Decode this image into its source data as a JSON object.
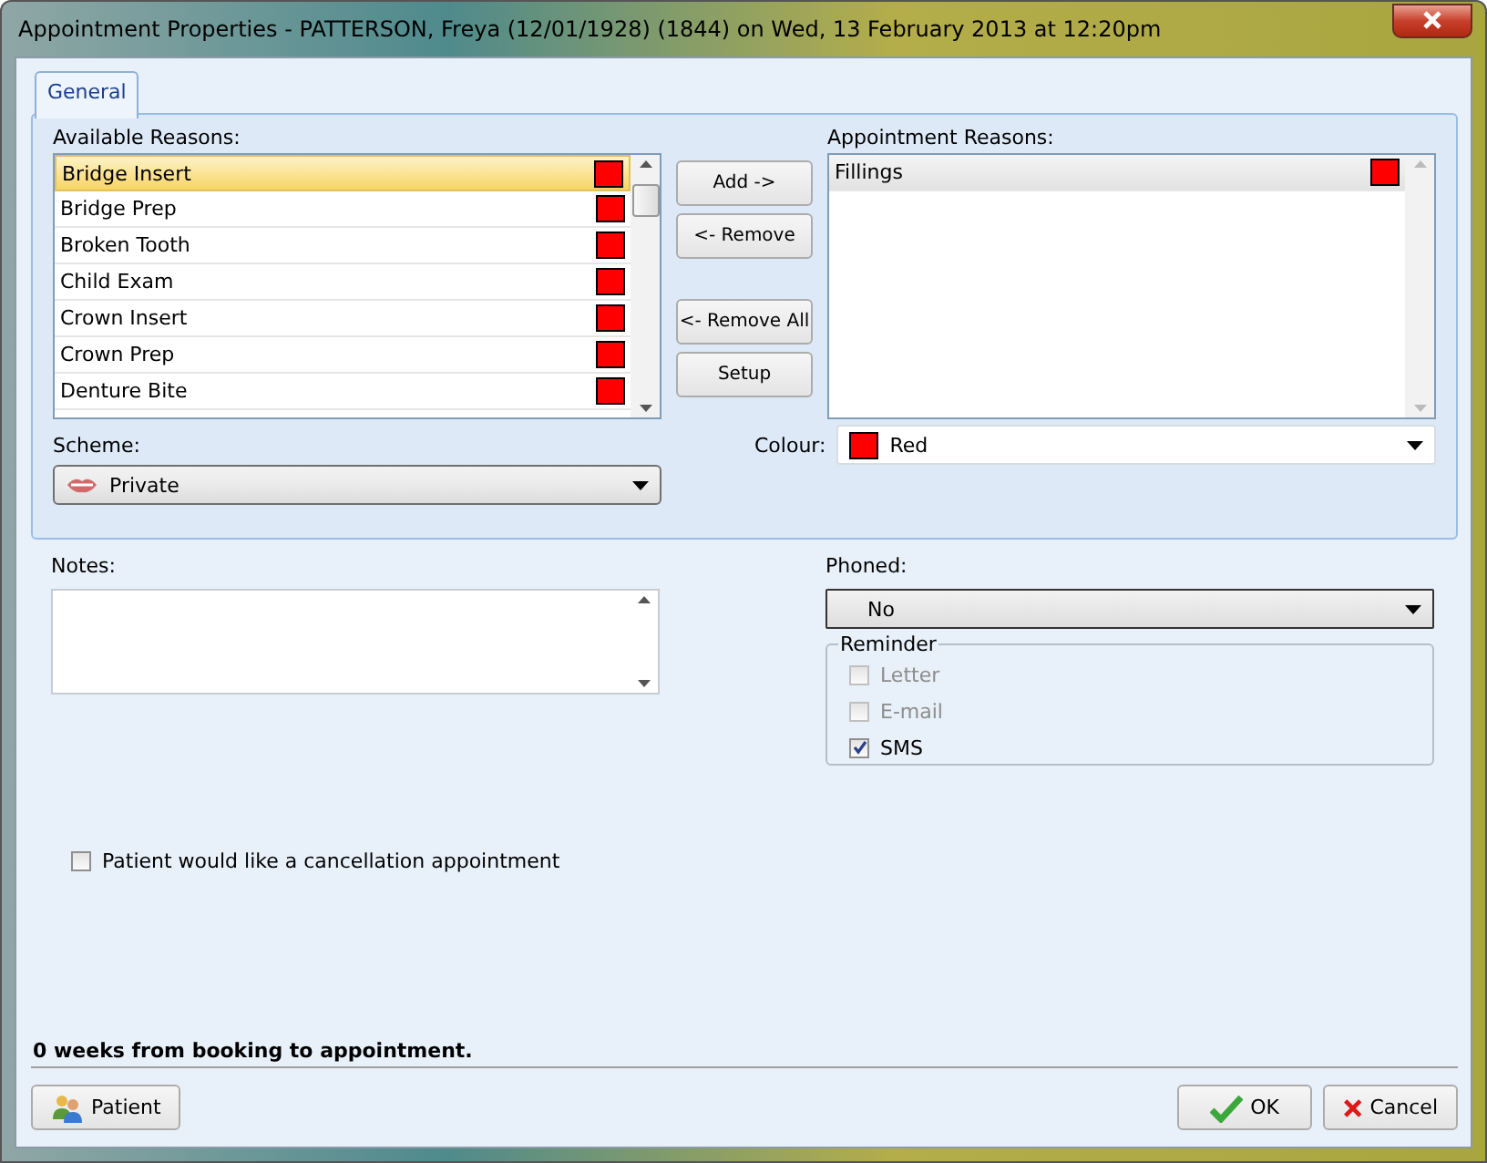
{
  "window": {
    "title": "Appointment Properties - PATTERSON, Freya (12/01/1928) (1844) on Wed, 13 February 2013 at 12:20pm"
  },
  "tabs": [
    {
      "label": "General",
      "selected": true
    }
  ],
  "available_reasons": {
    "label": "Available Reasons:",
    "items": [
      {
        "name": "Bridge Insert",
        "color": "#ff0000",
        "selected": true
      },
      {
        "name": "Bridge Prep",
        "color": "#ff0000",
        "selected": false
      },
      {
        "name": "Broken Tooth",
        "color": "#ff0000",
        "selected": false
      },
      {
        "name": "Child Exam",
        "color": "#ff0000",
        "selected": false
      },
      {
        "name": "Crown Insert",
        "color": "#ff0000",
        "selected": false
      },
      {
        "name": "Crown Prep",
        "color": "#ff0000",
        "selected": false
      },
      {
        "name": "Denture Bite",
        "color": "#ff0000",
        "selected": false
      }
    ]
  },
  "move_buttons": [
    "Add ->",
    "<- Remove",
    "<- Remove All",
    "Setup"
  ],
  "appointment_reasons": {
    "label": "Appointment Reasons:",
    "items": [
      {
        "name": "Fillings",
        "color": "#ff0000",
        "selected": true
      }
    ]
  },
  "scheme": {
    "label": "Scheme:",
    "value": "Private"
  },
  "colour": {
    "label": "Colour:",
    "value": "Red",
    "color": "#ff0000"
  },
  "notes": {
    "label": "Notes:"
  },
  "phoned": {
    "label": "Phoned:",
    "value": "No"
  },
  "reminder": {
    "label": "Reminder",
    "options": [
      {
        "label": "Letter",
        "checked": false,
        "disabled": true
      },
      {
        "label": "E-mail",
        "checked": false,
        "disabled": true
      },
      {
        "label": "SMS",
        "checked": true,
        "disabled": false
      }
    ]
  },
  "cancellation": {
    "label": "Patient would like a cancellation appointment",
    "checked": false
  },
  "status": "0 weeks from booking to appointment.",
  "buttons": {
    "patient": "Patient",
    "ok": "OK",
    "cancel": "Cancel"
  }
}
